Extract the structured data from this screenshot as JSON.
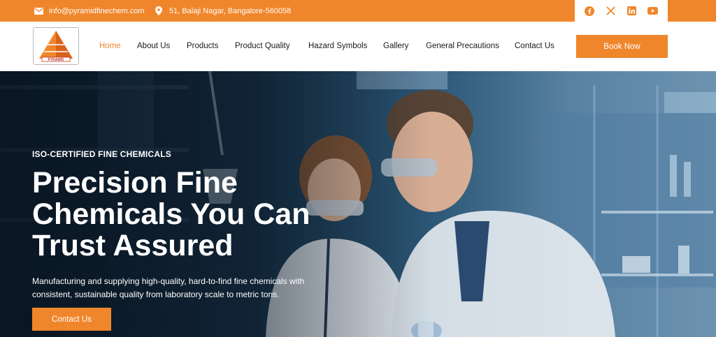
{
  "topbar": {
    "email": "info@pyramidfinechem.com",
    "address": "51, Balaji Nagar, Bangalore-560058",
    "social": [
      "facebook-icon",
      "x-icon",
      "linkedin-icon",
      "youtube-icon"
    ]
  },
  "brand": {
    "logo_text": "PYRAMID",
    "accent": "#f0862b"
  },
  "nav": {
    "items": [
      {
        "label": "Home",
        "active": true
      },
      {
        "label": "About Us"
      },
      {
        "label": "Products"
      },
      {
        "label": "Product Quality"
      },
      {
        "label": "Hazard Symbols"
      },
      {
        "label": "Gallery"
      },
      {
        "label": "General Precautions"
      },
      {
        "label": "Contact Us"
      }
    ],
    "cta": "Book Now"
  },
  "hero": {
    "eyebrow": "ISO-CERTIFIED FINE CHEMICALS",
    "headline": "Precision Fine Chemicals You Can Trust Assured",
    "subtext": "Manufacturing and supplying high-quality, hard-to-find fine chemicals with consistent, sustainable quality from laboratory scale to metric tons.",
    "button": "Contact Us"
  }
}
